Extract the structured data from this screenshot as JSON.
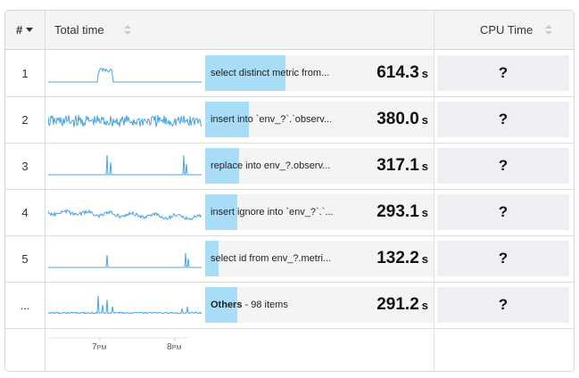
{
  "header": {
    "rank_label": "#",
    "total_time_label": "Total time",
    "cpu_time_label": "CPU Time"
  },
  "rows": [
    {
      "rank": "1",
      "query": "select distinct metric from...",
      "query_bold": "",
      "value": "614.3",
      "unit": "s",
      "cpu": "?",
      "fraction": 0.35,
      "spark": "flat-bump"
    },
    {
      "rank": "2",
      "query": "insert into `env_?`.`observ...",
      "query_bold": "",
      "value": "380.0",
      "unit": "s",
      "cpu": "?",
      "fraction": 0.19,
      "spark": "noisy"
    },
    {
      "rank": "3",
      "query": "replace into env_?.observ...",
      "query_bold": "",
      "value": "317.1",
      "unit": "s",
      "cpu": "?",
      "fraction": 0.15,
      "spark": "spikes"
    },
    {
      "rank": "4",
      "query": "insert ignore into `env_?`.`...",
      "query_bold": "",
      "value": "293.1",
      "unit": "s",
      "cpu": "?",
      "fraction": 0.14,
      "spark": "wavy"
    },
    {
      "rank": "5",
      "query": "select id from env_?.metri...",
      "query_bold": "",
      "value": "132.2",
      "unit": "s",
      "cpu": "?",
      "fraction": 0.06,
      "spark": "spikes-small"
    },
    {
      "rank": "...",
      "query": " - 98 items",
      "query_bold": "Others",
      "value": "291.2",
      "unit": "s",
      "cpu": "?",
      "fraction": 0.14,
      "spark": "others"
    }
  ],
  "axis": {
    "ticks": [
      {
        "hour": "7",
        "suffix": "PM"
      },
      {
        "hour": "8",
        "suffix": "PM"
      }
    ]
  },
  "colors": {
    "spark_line": "#4aa3df",
    "bar_fill": "#a9dcf6",
    "header_bg": "#f4f4f4"
  }
}
